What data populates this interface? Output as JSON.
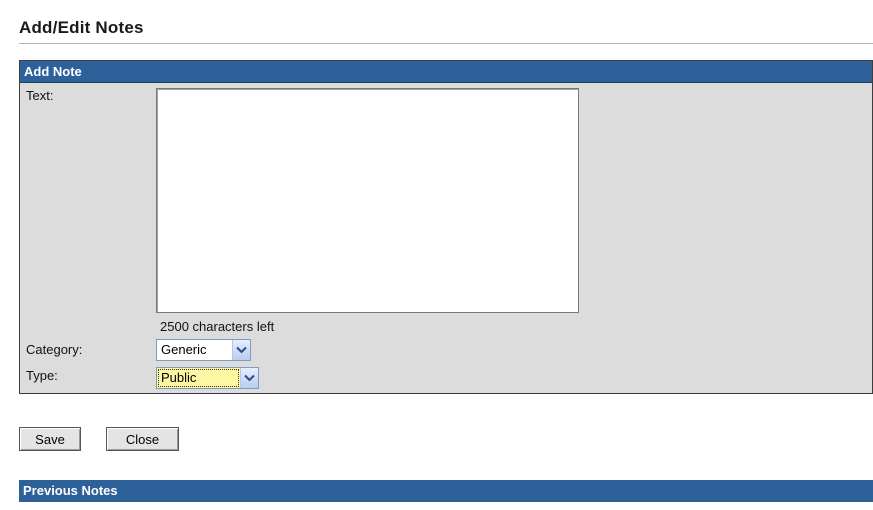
{
  "page": {
    "title": "Add/Edit Notes"
  },
  "add_note": {
    "header": "Add Note",
    "text_label": "Text:",
    "text_value": "",
    "chars_left": "2500  characters left",
    "category_label": "Category:",
    "category_value": "Generic",
    "type_label": "Type:",
    "type_value": "Public"
  },
  "actions": {
    "save_label": "Save",
    "close_label": "Close"
  },
  "previous_notes": {
    "header": "Previous Notes"
  },
  "colors": {
    "header_blue": "#2e6199",
    "panel_gray": "#dcdcdc",
    "highlight_yellow": "#fdf6a3"
  }
}
